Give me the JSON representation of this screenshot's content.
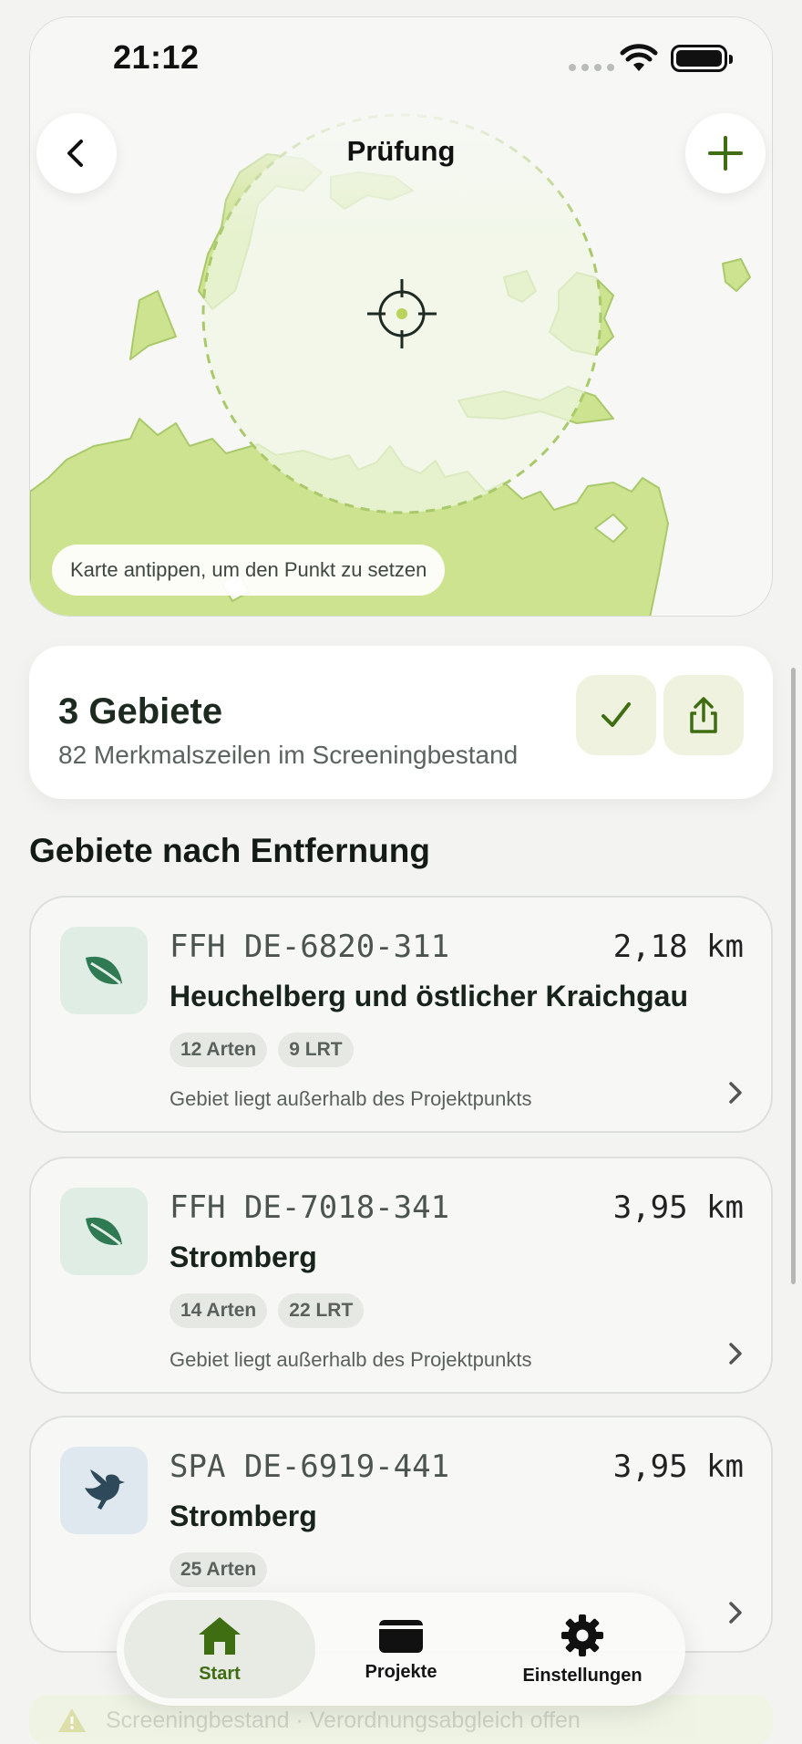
{
  "status_bar": {
    "time": "21:12"
  },
  "nav": {
    "title": "Prüfung"
  },
  "map": {
    "hint": "Karte antippen, um den Punkt zu setzen"
  },
  "summary": {
    "count": "3 Gebiete",
    "subtitle": "82 Merkmalszeilen im Screeningbestand"
  },
  "section_title": "Gebiete nach Entfernung",
  "areas": [
    {
      "code": "FFH DE-6820-311",
      "distance": "2,18 km",
      "name": "Heuchelberg und östlicher Kraichgau",
      "chips": [
        "12 Arten",
        "9 LRT"
      ],
      "note": "Gebiet liegt außerhalb des Projektpunkts",
      "icon": "leaf-icon"
    },
    {
      "code": "FFH DE-7018-341",
      "distance": "3,95 km",
      "name": "Stromberg",
      "chips": [
        "14 Arten",
        "22 LRT"
      ],
      "note": "Gebiet liegt außerhalb des Projektpunkts",
      "icon": "leaf-icon"
    },
    {
      "code": "SPA DE-6919-441",
      "distance": "3,95 km",
      "name": "Stromberg",
      "chips": [
        "25 Arten"
      ],
      "note": "",
      "icon": "bird-icon"
    }
  ],
  "tabs": [
    {
      "label": "Start",
      "icon": "home-icon",
      "active": true
    },
    {
      "label": "Projekte",
      "icon": "folder-icon",
      "active": false
    },
    {
      "label": "Einstellungen",
      "icon": "gear-icon",
      "active": false
    }
  ],
  "banner": {
    "text": "Screeningbestand · Verordnungsabgleich offen"
  },
  "colors": {
    "accent": "#3f6d12",
    "map_fill": "#cde38f",
    "map_stroke": "#a9c96a",
    "leaf": "#2f7a52",
    "bird": "#2e4a5a"
  }
}
